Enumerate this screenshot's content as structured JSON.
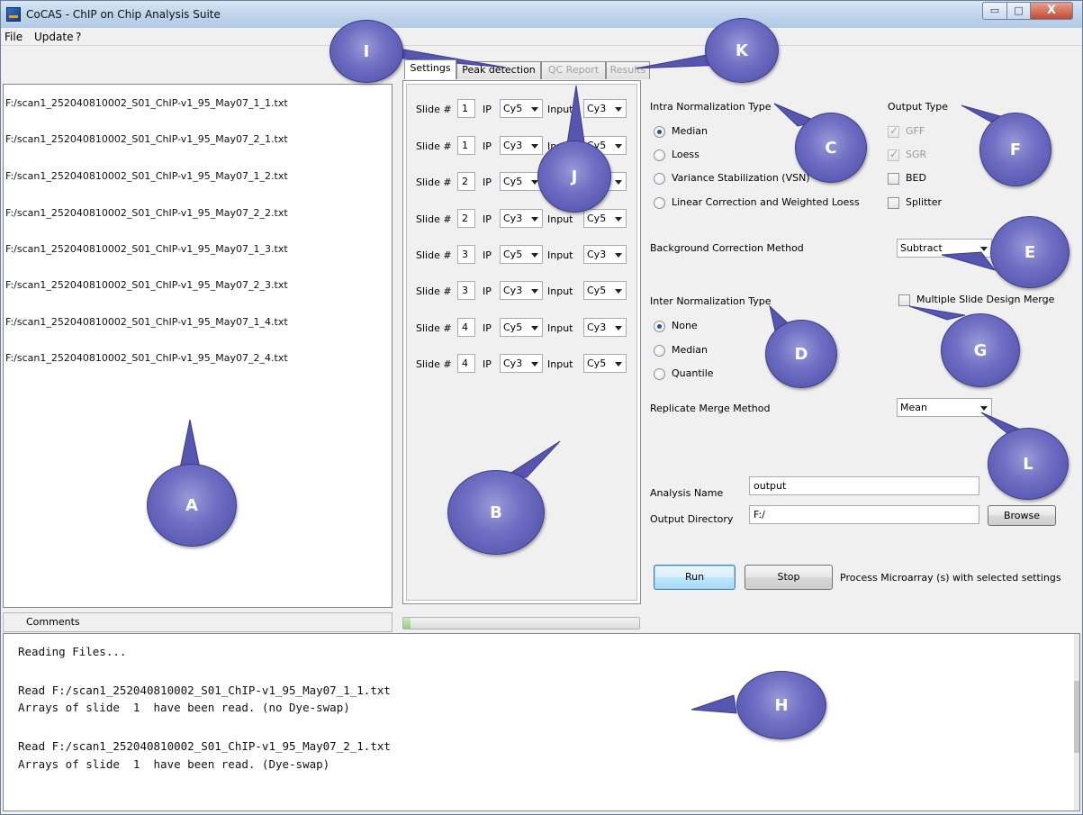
{
  "window": {
    "title": "CoCAS - ChIP on Chip Analysis Suite",
    "min_icon": "▭",
    "max_icon": "□",
    "close_icon": "X"
  },
  "menu": [
    "File",
    "Update",
    "?"
  ],
  "files": [
    "F:/scan1_252040810002_S01_ChIP-v1_95_May07_1_1.txt",
    "F:/scan1_252040810002_S01_ChIP-v1_95_May07_2_1.txt",
    "F:/scan1_252040810002_S01_ChIP-v1_95_May07_1_2.txt",
    "F:/scan1_252040810002_S01_ChIP-v1_95_May07_2_2.txt",
    "F:/scan1_252040810002_S01_ChIP-v1_95_May07_1_3.txt",
    "F:/scan1_252040810002_S01_ChIP-v1_95_May07_2_3.txt",
    "F:/scan1_252040810002_S01_ChIP-v1_95_May07_1_4.txt",
    "F:/scan1_252040810002_S01_ChIP-v1_95_May07_2_4.txt"
  ],
  "tabs": [
    "Settings",
    "Peak detection",
    "QC Report",
    "Results"
  ],
  "slide_labels": {
    "slide": "Slide #",
    "ip": "IP",
    "input": "Input"
  },
  "slides": [
    {
      "num": "1",
      "ip": "Cy5",
      "input": "Cy3"
    },
    {
      "num": "1",
      "ip": "Cy3",
      "input": "Cy5"
    },
    {
      "num": "2",
      "ip": "Cy5",
      "input": "Cy3"
    },
    {
      "num": "2",
      "ip": "Cy3",
      "input": "Cy5"
    },
    {
      "num": "3",
      "ip": "Cy5",
      "input": "Cy3"
    },
    {
      "num": "3",
      "ip": "Cy3",
      "input": "Cy5"
    },
    {
      "num": "4",
      "ip": "Cy5",
      "input": "Cy3"
    },
    {
      "num": "4",
      "ip": "Cy3",
      "input": "Cy5"
    }
  ],
  "intra": {
    "label": "Intra Normalization Type",
    "options": [
      "Median",
      "Loess",
      "Variance Stabilization (VSN)",
      "Linear Correction and Weighted Loess"
    ]
  },
  "output_type": {
    "label": "Output Type",
    "options": [
      "GFF",
      "SGR",
      "BED",
      "Splitter"
    ]
  },
  "background": {
    "label": "Background Correction Method",
    "value": "Subtract"
  },
  "inter": {
    "label": "Inter Normalization Type",
    "options": [
      "None",
      "Median",
      "Quantile"
    ]
  },
  "multi_slide": {
    "label": "Multiple Slide Design Merge"
  },
  "replicate": {
    "label": "Replicate Merge Method",
    "value": "Mean"
  },
  "analysis": {
    "name_label": "Analysis Name",
    "name_value": "output",
    "dir_label": "Output Directory",
    "dir_value": "F:/"
  },
  "buttons": {
    "browse": "Browse",
    "run": "Run",
    "stop": "Stop"
  },
  "process_text": "Process Microarray (s) with selected settings",
  "comments_label": "Comments",
  "progress": 0.03,
  "console": [
    "Reading Files...",
    "",
    "Read F:/scan1_252040810002_S01_ChIP-v1_95_May07_1_1.txt",
    "Arrays of slide  1  have been read. (no Dye-swap)",
    "",
    "Read F:/scan1_252040810002_S01_ChIP-v1_95_May07_2_1.txt",
    "Arrays of slide  1  have been read. (Dye-swap)"
  ],
  "callouts": [
    "I",
    "K",
    "C",
    "F",
    "J",
    "E",
    "G",
    "D",
    "L",
    "A",
    "B",
    "H"
  ]
}
